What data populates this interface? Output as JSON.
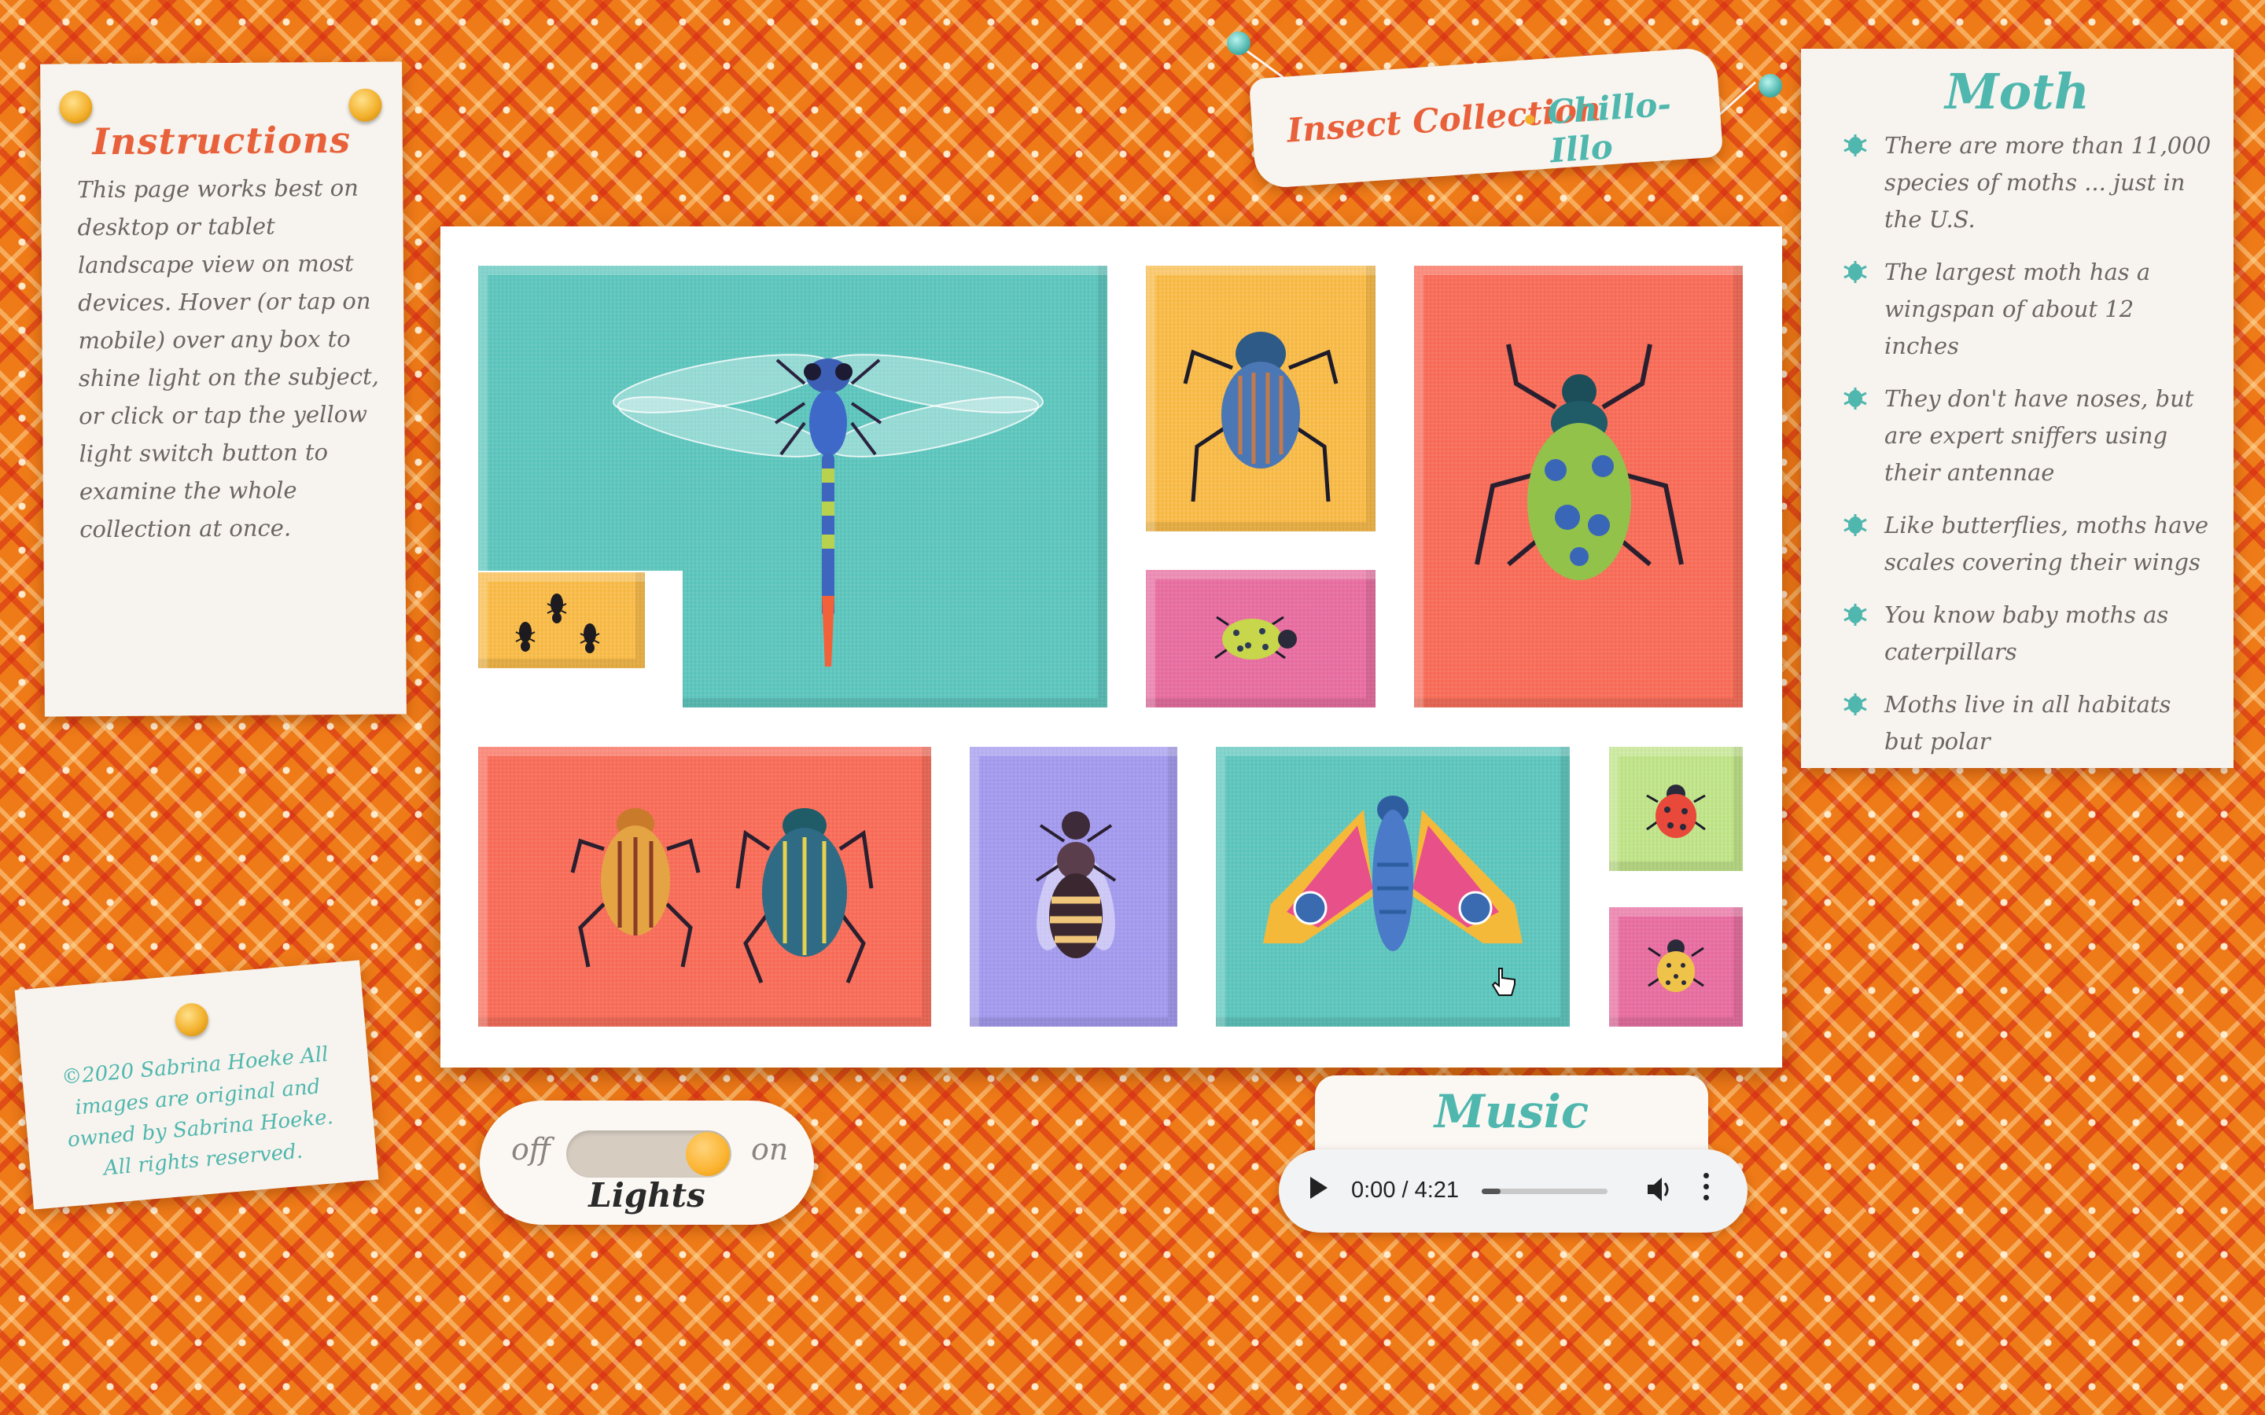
{
  "instructions": {
    "title": "Instructions",
    "body": "This page works best on desktop or tablet landscape view on most devices. Hover (or tap on mobile) over any box to shine light on the subject, or click or tap the yellow light switch button to examine the whole collection at once."
  },
  "copyright": "©2020 Sabrina Hoeke All images are original and owned by Sabrina Hoeke. All rights reserved.",
  "banner": {
    "title": "Insect Collection",
    "author": "Chillo-Illo"
  },
  "facts": {
    "title": "Moth",
    "items": [
      "There are more than 11,000 species of moths ... just in the U.S.",
      "The largest moth has a wingspan of about 12 inches",
      "They don't have noses, but are expert sniffers using their antennae",
      "Like butterflies, moths have scales covering their wings",
      "You know baby moths as caterpillars",
      "Moths live in all habitats but polar"
    ]
  },
  "lights": {
    "off_label": "off",
    "on_label": "on",
    "title": "Lights",
    "state": "on"
  },
  "music": {
    "title": "Music",
    "time": "0:00 / 4:21",
    "progress": 0.15
  },
  "colors": {
    "teal": "#5fc8bf",
    "yellow": "#fbbd4a",
    "coral": "#fb6e5a",
    "pink": "#ea6fa2",
    "purple": "#a59cf0",
    "lime": "#c2e68a",
    "accent_orange": "#e8613a"
  },
  "icons": [
    "play-icon",
    "volume-icon",
    "more-options-icon",
    "bug-bullet-icon",
    "pointer-cursor-icon"
  ]
}
